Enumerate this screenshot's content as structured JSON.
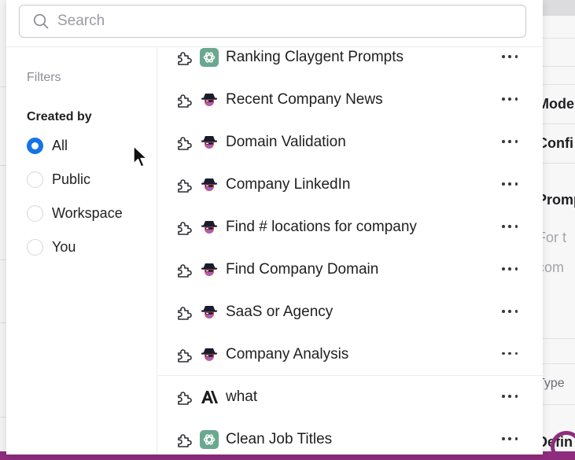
{
  "search": {
    "placeholder": "Search",
    "value": ""
  },
  "sidebar": {
    "filters_label": "Filters",
    "created_by_label": "Created by",
    "options": [
      {
        "label": "All",
        "checked": true
      },
      {
        "label": "Public",
        "checked": false
      },
      {
        "label": "Workspace",
        "checked": false
      },
      {
        "label": "You",
        "checked": false
      }
    ]
  },
  "list": {
    "items": [
      {
        "label": "Ranking Claygent Prompts",
        "logo": "openai-logo-icon"
      },
      {
        "label": "Recent Company News",
        "logo": "claygent-logo-icon"
      },
      {
        "label": "Domain Validation",
        "logo": "claygent-logo-icon"
      },
      {
        "label": "Company LinkedIn",
        "logo": "claygent-logo-icon"
      },
      {
        "label": "Find # locations for company",
        "logo": "claygent-logo-icon"
      },
      {
        "label": "Find Company Domain",
        "logo": "claygent-logo-icon"
      },
      {
        "label": "SaaS or Agency",
        "logo": "claygent-logo-icon"
      },
      {
        "label": "Company Analysis",
        "logo": "claygent-logo-icon"
      },
      {
        "label": "what",
        "logo": "anthropic-logo-icon"
      },
      {
        "label": "Clean Job Titles",
        "logo": "openai-logo-icon"
      }
    ]
  },
  "background": {
    "fragments": [
      "Mode",
      "Confi",
      "Promp",
      "For t",
      "com",
      "Type",
      "Defin"
    ]
  },
  "colors": {
    "accent": "#1573e6",
    "openai_tile": "#6aa88f",
    "purple_bar": "#8e2d7e"
  }
}
